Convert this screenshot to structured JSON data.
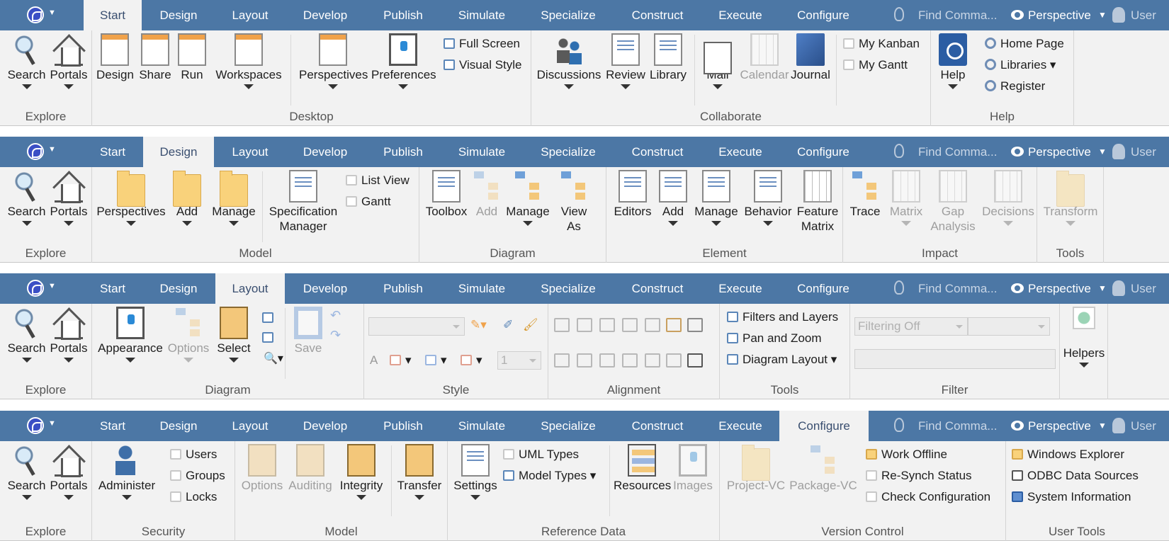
{
  "tabs": [
    "Start",
    "Design",
    "Layout",
    "Develop",
    "Publish",
    "Simulate",
    "Specialize",
    "Construct",
    "Execute",
    "Configure"
  ],
  "header": {
    "find_label": "Find Comma...",
    "perspective_label": "Perspective",
    "user_label": "User"
  },
  "colors": {
    "tabbar": "#4c77a5",
    "ribbon": "#f2f2f2",
    "disabled_text": "#9e9e9e"
  },
  "ribbons": [
    {
      "active_tab": "Start",
      "groups": [
        {
          "label": "Explore",
          "big": [
            "Search",
            "Portals"
          ]
        },
        {
          "label": "Desktop",
          "big": [
            "Design",
            "Share",
            "Run",
            "Workspaces",
            "Perspectives",
            "Preferences"
          ],
          "small": [
            "Full Screen",
            "Visual Style"
          ]
        },
        {
          "label": "Collaborate",
          "big": [
            "Discussions",
            "Review",
            "Library",
            "Mail",
            "Calendar",
            "Journal"
          ],
          "small": [
            "My Kanban",
            "My Gantt"
          ]
        },
        {
          "label": "Help",
          "big": [
            "Help"
          ],
          "small": [
            "Home Page",
            "Libraries",
            "Register"
          ]
        }
      ]
    },
    {
      "active_tab": "Design",
      "groups": [
        {
          "label": "Explore",
          "big": [
            "Search",
            "Portals"
          ]
        },
        {
          "label": "Model",
          "big": [
            "Perspectives",
            "Add",
            "Manage",
            "Specification",
            "Manager"
          ],
          "small": [
            "List View",
            "Gantt"
          ]
        },
        {
          "label": "Diagram",
          "big": [
            "Toolbox",
            "Add",
            "Manage",
            "View",
            "As"
          ]
        },
        {
          "label": "Element",
          "big": [
            "Editors",
            "Add",
            "Manage",
            "Behavior",
            "Feature",
            "Matrix"
          ]
        },
        {
          "label": "Impact",
          "big": [
            "Trace",
            "Matrix",
            "Gap",
            "Analysis",
            "Decisions"
          ]
        },
        {
          "label": "Tools",
          "big": [
            "Transform"
          ]
        }
      ]
    },
    {
      "active_tab": "Layout",
      "groups": [
        {
          "label": "Explore",
          "big": [
            "Search",
            "Portals"
          ]
        },
        {
          "label": "Diagram",
          "big": [
            "Appearance",
            "Options",
            "Select",
            "Save"
          ]
        },
        {
          "label": "Style",
          "spin_value": "1"
        },
        {
          "label": "Alignment"
        },
        {
          "label": "Tools",
          "small": [
            "Filters and Layers",
            "Pan and Zoom",
            "Diagram Layout"
          ]
        },
        {
          "label": "Filter",
          "combo": "Filtering Off"
        },
        {
          "label": "",
          "big": [
            "Helpers"
          ]
        }
      ]
    },
    {
      "active_tab": "Configure",
      "groups": [
        {
          "label": "Explore",
          "big": [
            "Search",
            "Portals"
          ]
        },
        {
          "label": "Security",
          "big": [
            "Administer"
          ],
          "small": [
            "Users",
            "Groups",
            "Locks"
          ]
        },
        {
          "label": "Model",
          "big": [
            "Options",
            "Auditing",
            "Integrity",
            "Transfer"
          ]
        },
        {
          "label": "Reference Data",
          "big": [
            "Settings",
            "Resources",
            "Images"
          ],
          "small": [
            "UML Types",
            "Model Types"
          ]
        },
        {
          "label": "Version Control",
          "big": [
            "Project-VC",
            "Package-VC"
          ],
          "small": [
            "Work Offline",
            "Re-Synch Status",
            "Check Configuration"
          ]
        },
        {
          "label": "User Tools",
          "small": [
            "Windows Explorer",
            "ODBC Data Sources",
            "System Information"
          ]
        }
      ]
    }
  ]
}
